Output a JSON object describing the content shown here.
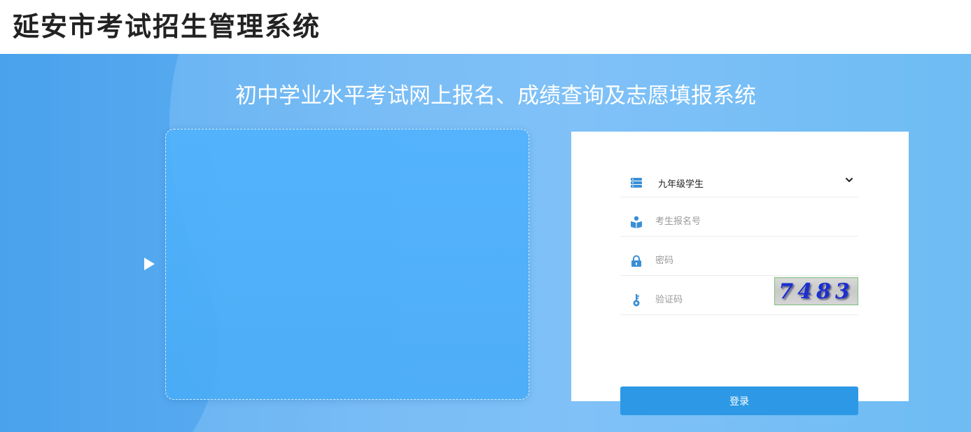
{
  "header": {
    "title": "延安市考试招生管理系统"
  },
  "banner": {
    "subtitle": "初中学业水平考试网上报名、成绩查询及志愿填报系统"
  },
  "login": {
    "user_type": {
      "selected": "九年级学生",
      "icon": "server-stack-icon"
    },
    "username": {
      "placeholder": "考生报名号",
      "icon": "reader-icon"
    },
    "password": {
      "placeholder": "密码",
      "icon": "lock-icon"
    },
    "verify_code": {
      "placeholder": "验证码",
      "icon": "key-icon",
      "captcha_text": "7483"
    },
    "submit_label": "登录"
  },
  "colors": {
    "accent": "#2d99e6",
    "icon": "#3a8fd6",
    "banner": "#5cafef"
  }
}
